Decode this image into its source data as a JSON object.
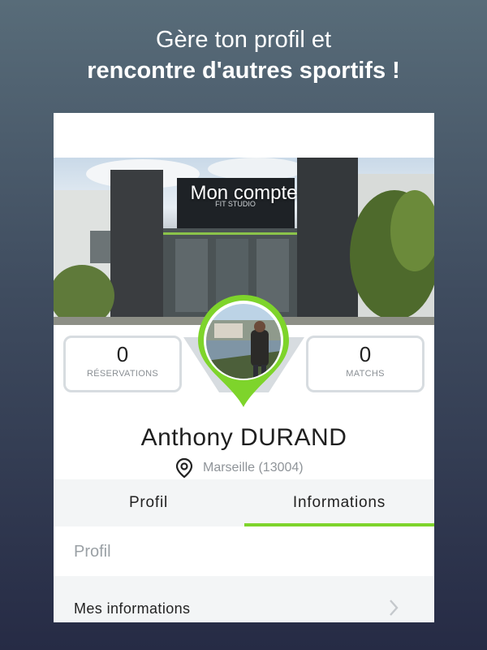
{
  "headline": {
    "line1": "Gère ton profil et",
    "line2": "rencontre d'autres sportifs !"
  },
  "banner": {
    "title": "Mon compte"
  },
  "stats": {
    "reservations": {
      "value": "0",
      "label": "RÉSERVATIONS"
    },
    "matchs": {
      "value": "0",
      "label": "MATCHS"
    }
  },
  "user": {
    "name": "Anthony  DURAND",
    "location": "Marseille (13004)"
  },
  "tabs": [
    {
      "label": "Profil",
      "active": false
    },
    {
      "label": "Informations",
      "active": true
    }
  ],
  "section": {
    "header": "Profil"
  },
  "rows": [
    {
      "label": "Mes informations",
      "icon": "chevron-right-icon"
    }
  ],
  "colors": {
    "accent": "#7ed42b",
    "card_border": "#d7dce0",
    "muted_text": "#8f9499"
  }
}
